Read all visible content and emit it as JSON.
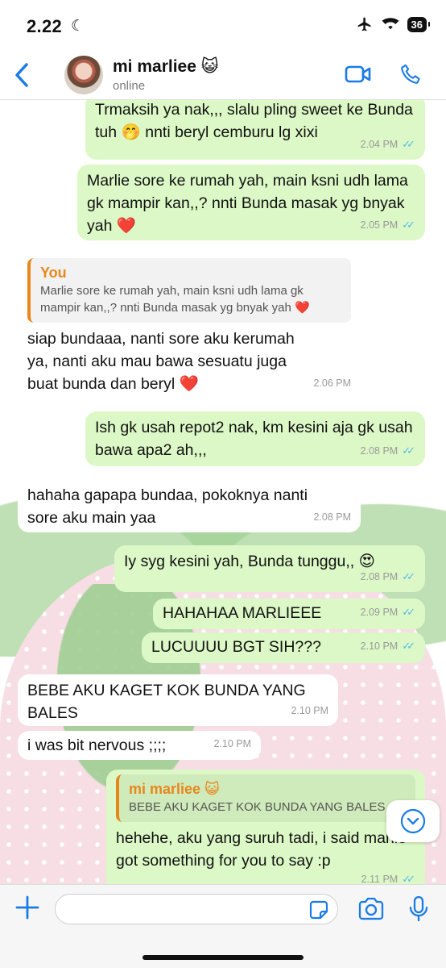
{
  "status_bar": {
    "time": "2.22",
    "battery": "36"
  },
  "header": {
    "contact_name": "mi marliee 😺",
    "contact_status": "online"
  },
  "messages": [
    {
      "dir": "out",
      "text": "Trmaksih ya nak,,, slalu pling sweet ke Bunda tuh 🤭 nnti beryl cemburu lg xixi",
      "time": "2.04 PM"
    },
    {
      "dir": "out",
      "text": "Marlie sore ke rumah yah, main ksni udh lama gk mampir kan,,? nnti Bunda masak yg bnyak yah ❤️",
      "time": "2.05 PM"
    },
    {
      "dir": "in",
      "quote_name": "You",
      "quote_text": "Marlie sore ke rumah yah, main ksni udh lama gk mampir kan,,? nnti Bunda masak yg bnyak yah ❤️",
      "text": "siap bundaaa, nanti sore aku kerumah ya, nanti aku mau bawa sesuatu juga buat bunda dan beryl ❤️",
      "time": "2.06 PM"
    },
    {
      "dir": "out",
      "text": "Ish gk usah repot2 nak, km kesini aja gk usah bawa apa2 ah,,,",
      "time": "2.08 PM"
    },
    {
      "dir": "in",
      "text": "hahaha gapapa bundaa, pokoknya nanti sore aku main yaa",
      "time": "2.08 PM"
    },
    {
      "dir": "out",
      "text": "Iy syg kesini yah, Bunda tunggu,, 😍",
      "time": "2.08 PM"
    },
    {
      "dir": "out",
      "text": "HAHAHAA MARLIEEE",
      "time": "2.09 PM"
    },
    {
      "dir": "out",
      "text": "LUCUUUU BGT SIH???",
      "time": "2.10 PM"
    },
    {
      "dir": "in",
      "text": "BEBE AKU KAGET KOK BUNDA YANG BALES",
      "time": "2.10 PM"
    },
    {
      "dir": "in",
      "text": "i was bit nervous ;;;;",
      "time": "2.10 PM"
    },
    {
      "dir": "out",
      "quote_name": "mi marliee 😺",
      "quote_text": "BEBE AKU KAGET KOK BUNDA YANG BALES",
      "text": "hehehe, aku yang suruh tadi, i said marlie got something for you to say :p",
      "time": "2.11 PM"
    }
  ],
  "input": {
    "placeholder": "",
    "value": ""
  },
  "icons": {
    "back": "chevron-left-icon",
    "video": "video-camera-icon",
    "call": "phone-icon",
    "attach": "plus-icon",
    "sticker": "sticker-icon",
    "camera": "camera-icon",
    "mic": "microphone-icon",
    "scroll": "chevron-down-icon"
  },
  "colors": {
    "accent": "#1a7be8",
    "outgoing_bubble": "#dcf8c6",
    "incoming_bubble": "#ffffff",
    "read_ticks": "#53bdeb",
    "quote_name": "#e8861c"
  }
}
